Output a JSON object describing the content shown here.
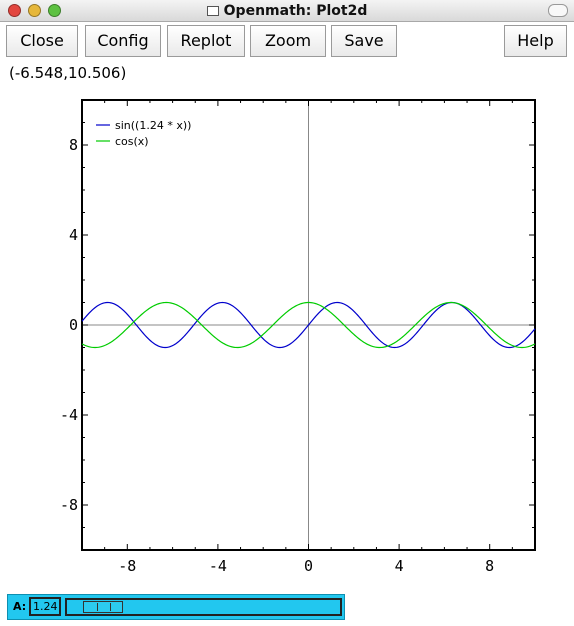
{
  "window": {
    "title": "Openmath: Plot2d"
  },
  "toolbar": {
    "close_label": "Close",
    "config_label": "Config",
    "replot_label": "Replot",
    "zoom_label": "Zoom",
    "save_label": "Save",
    "help_label": "Help"
  },
  "status": {
    "coordinates": "(-6.548,10.506)"
  },
  "slider": {
    "label": "A:",
    "value": "1.24",
    "level": 0.06
  },
  "colors": {
    "axis_line": "#888888",
    "frame": "#000000",
    "slider_bg": "#22c7ef"
  },
  "chart_data": {
    "type": "line",
    "title": "",
    "xlabel": "",
    "ylabel": "",
    "xlim": [
      -10,
      10
    ],
    "ylim": [
      -10,
      10
    ],
    "xticks": [
      "-8",
      "-4",
      "0",
      "4",
      "8"
    ],
    "yticks": [
      "8",
      "4",
      "0",
      "-4",
      "-8"
    ],
    "legend_position": "top-left",
    "series": [
      {
        "name": "sin((1.24 * x))",
        "color": "#0000cc",
        "function": "sin(1.24*x)"
      },
      {
        "name": "cos(x)",
        "color": "#00cc00",
        "function": "cos(x)"
      }
    ]
  }
}
